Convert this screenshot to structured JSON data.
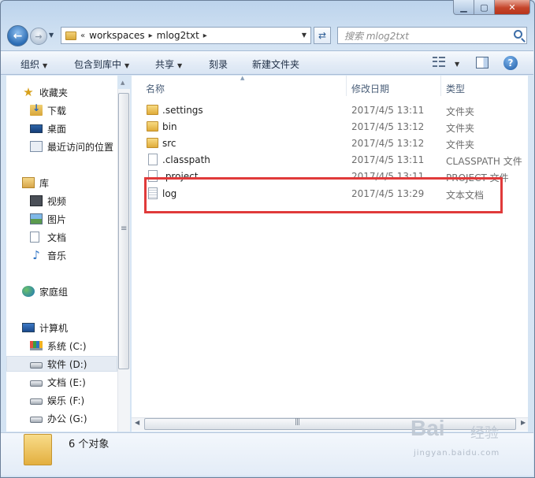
{
  "address": {
    "overflow": "«",
    "crumbs": [
      "workspaces",
      "mlog2txt"
    ],
    "refresh_icon": "refresh-arrows-icon"
  },
  "search": {
    "placeholder": "搜索 mlog2txt"
  },
  "toolbar": {
    "organize": "组织",
    "include_in_library": "包含到库中",
    "share": "共享",
    "burn": "刻录",
    "new_folder": "新建文件夹",
    "help": "?"
  },
  "nav": {
    "favorites": "收藏夹",
    "downloads": "下载",
    "desktop": "桌面",
    "recent": "最近访问的位置",
    "libraries": "库",
    "videos": "视频",
    "pictures": "图片",
    "documents": "文档",
    "music": "音乐",
    "homegroup": "家庭组",
    "computer": "计算机",
    "drives": [
      {
        "label": "系统 (C:)",
        "icon": "windows-drive-icon"
      },
      {
        "label": "软件 (D:)",
        "icon": "drive-icon"
      },
      {
        "label": "文档 (E:)",
        "icon": "drive-icon"
      },
      {
        "label": "娱乐 (F:)",
        "icon": "drive-icon"
      },
      {
        "label": "办公 (G:)",
        "icon": "drive-icon"
      }
    ]
  },
  "columns": {
    "name": "名称",
    "date": "修改日期",
    "type": "类型"
  },
  "files": [
    {
      "name": ".settings",
      "date": "2017/4/5 13:11",
      "type": "文件夹",
      "icon": "folder"
    },
    {
      "name": "bin",
      "date": "2017/4/5 13:12",
      "type": "文件夹",
      "icon": "folder"
    },
    {
      "name": "src",
      "date": "2017/4/5 13:12",
      "type": "文件夹",
      "icon": "folder"
    },
    {
      "name": ".classpath",
      "date": "2017/4/5 13:11",
      "type": "CLASSPATH 文件",
      "icon": "file"
    },
    {
      "name": ".project",
      "date": "2017/4/5 13:11",
      "type": "PROJECT 文件",
      "icon": "file"
    },
    {
      "name": "log",
      "date": "2017/4/5 13:29",
      "type": "文本文档",
      "icon": "text"
    }
  ],
  "status": {
    "count_text": "6 个对象"
  },
  "watermark": {
    "brand": "Bai",
    "brand_cn": "经验",
    "url": "jingyan.baidu.com"
  },
  "colors": {
    "highlight": "#e03a3a",
    "close_button": "#c5452b"
  }
}
